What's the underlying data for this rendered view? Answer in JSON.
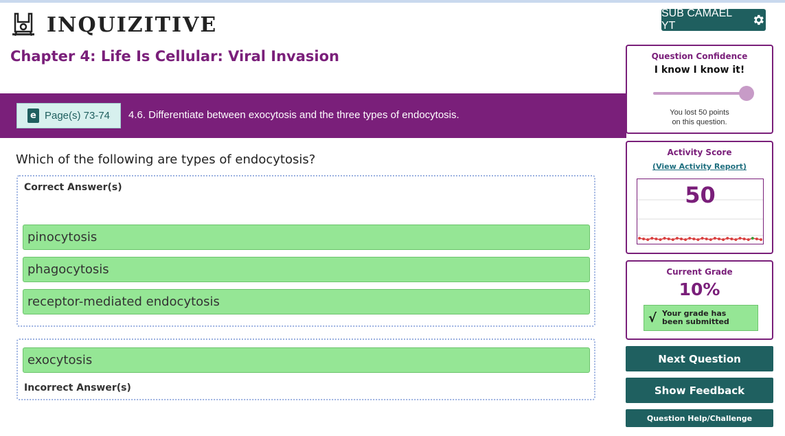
{
  "app": {
    "logo_text": "INQUIZITIVE",
    "user_button_label": "SUB CAMAEL YT",
    "chapter_title": "Chapter 4: Life Is Cellular: Viral Invasion"
  },
  "objective": {
    "page_button_label": "Page(s) 73-74",
    "book_icon_letter": "e",
    "text": "4.6. Differentiate between exocytosis and the three types of endocytosis."
  },
  "question": {
    "prompt": "Which of the following are types of endocytosis?",
    "correct_label": "Correct Answer(s)",
    "incorrect_label": "Incorrect Answer(s)",
    "correct_answers": [
      "pinocytosis",
      "phagocytosis",
      "receptor-mediated endocytosis"
    ],
    "incorrect_answers": [
      "exocytosis"
    ]
  },
  "confidence": {
    "title": "Question Confidence",
    "level": "I know I know it!",
    "slider_level": 1.0,
    "note_line1": "You lost 50 points",
    "note_line2": "on this question."
  },
  "activity": {
    "title": "Activity Score",
    "report_link": "(View Activity Report)",
    "score": "50"
  },
  "grade": {
    "title": "Current Grade",
    "value": "10%",
    "submitted_text": "Your grade has\nbeen submitted"
  },
  "buttons": {
    "next": "Next Question",
    "feedback": "Show Feedback",
    "help": "Question Help/Challenge"
  },
  "colors": {
    "brand_purple": "#7a1f7a",
    "teal": "#1f6060",
    "answer_green": "#95e695"
  }
}
